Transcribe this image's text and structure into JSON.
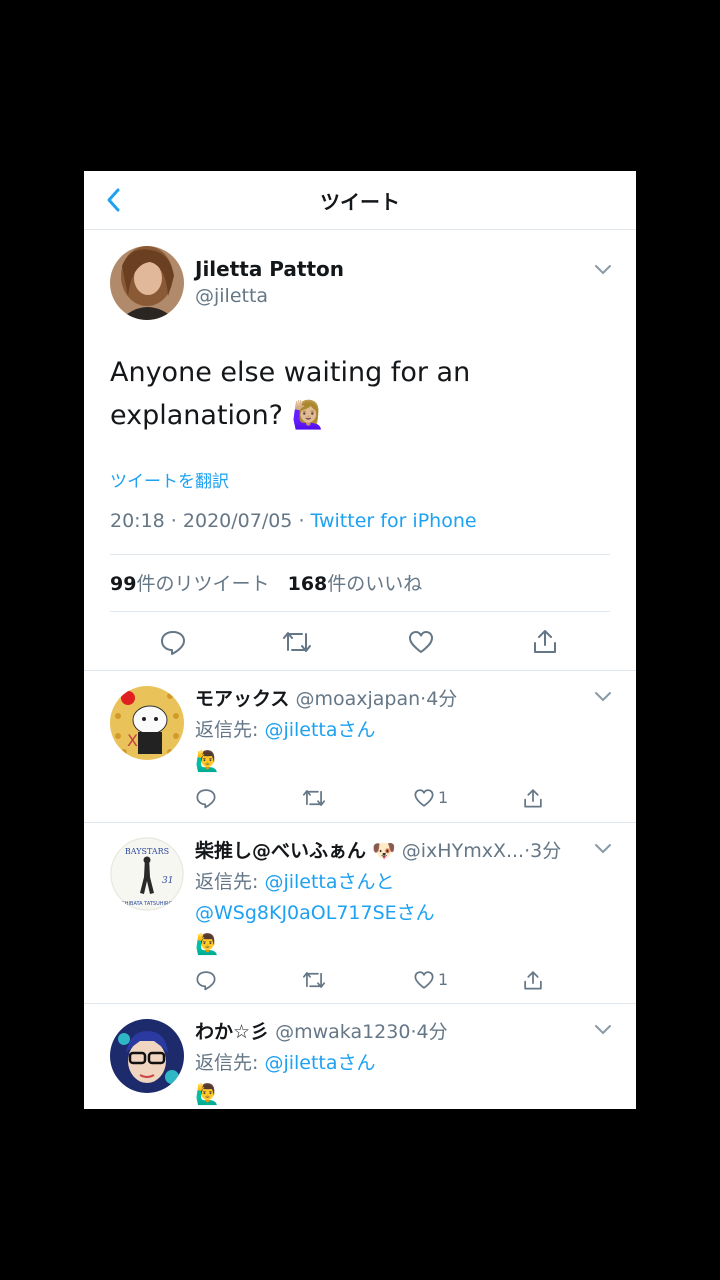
{
  "header": {
    "title": "ツイート"
  },
  "tweet": {
    "name": "Jiletta Patton",
    "handle": "@jiletta",
    "text_line1": "Anyone else waiting for an",
    "text_line2": "explanation?",
    "emoji": "🙋🏼‍♀️",
    "translate": "ツイートを翻訳",
    "time": "20:18",
    "date": "2020/07/05",
    "source": "Twitter for iPhone",
    "retweets_count": "99",
    "retweets_label": "件のリツイート",
    "likes_count": "168",
    "likes_label": "件のいいね"
  },
  "replies": [
    {
      "name": "モアックス",
      "handle": "@moaxjapan",
      "time": "4分",
      "reply_to_label": "返信先: ",
      "reply_to": "@jiletta",
      "reply_to_suffix": "さん",
      "emoji": "🙋‍♂️",
      "like_count": "1"
    },
    {
      "name": "柴推し@べいふぁん",
      "name_emoji": "🐶",
      "handle": "@ixHYmxX...",
      "time": "3分",
      "reply_to_label": "返信先: ",
      "reply_to": "@jiletta",
      "reply_to_mid": "さんと",
      "reply_to2": "@WSg8KJ0aOL717SE",
      "reply_to_suffix": "さん",
      "emoji": "🙋‍♂️",
      "like_count": "1",
      "avatar_text_top": "BAYSTARS",
      "avatar_text_num": "31",
      "avatar_text_bottom": "SHIBATA TATSUHIRO"
    },
    {
      "name": "わか☆彡",
      "handle": "@mwaka1230",
      "time": "4分",
      "reply_to_label": "返信先: ",
      "reply_to": "@jiletta",
      "reply_to_suffix": "さん",
      "emoji": "🙋‍♂️"
    }
  ],
  "colors": {
    "accent": "#1da1f2",
    "text": "#14171a",
    "muted": "#657786",
    "border": "#e1e8ed"
  }
}
